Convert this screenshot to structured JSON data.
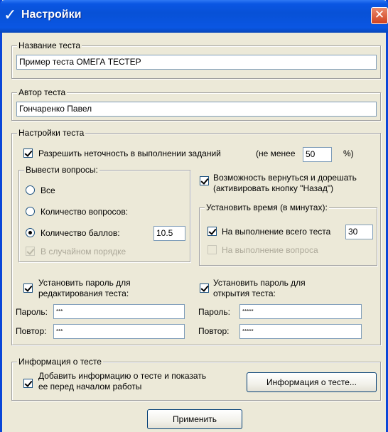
{
  "window": {
    "title": "Настройки",
    "title_icon": "checkmark-icon",
    "close_icon": "close-icon",
    "colors": {
      "titlebar": "#0A56E3",
      "frame": "#0A46D8",
      "background": "#ECE9D8",
      "close": "#D0411F"
    }
  },
  "test_name": {
    "legend": "Название теста",
    "value": "Пример теста ОМЕГА ТЕСТЕР"
  },
  "test_author": {
    "legend": "Автор теста",
    "value": "Гончаренко Павел"
  },
  "test_settings": {
    "legend": "Настройки теста",
    "allow_inaccuracy": {
      "label": "Разрешить неточность в выполнении заданий",
      "checked": true
    },
    "min_prefix": "(не менее",
    "min_value": "50",
    "min_suffix": "%)",
    "output_questions": {
      "legend": "Вывести вопросы:",
      "all": {
        "label": "Все",
        "selected": false
      },
      "count": {
        "label": "Количество вопросов:",
        "selected": false
      },
      "points": {
        "label": "Количество баллов:",
        "selected": true
      },
      "points_value": "10.5",
      "random": {
        "label": "В случайном порядке",
        "checked": true,
        "disabled": true
      }
    },
    "allow_return": {
      "label_line1": "Возможность вернуться и дорешать",
      "label_line2": "(активировать кнопку \"Назад\")",
      "checked": true
    },
    "time": {
      "legend": "Установить время (в минутах):",
      "whole_test": {
        "label": "На выполнение всего теста",
        "checked": true,
        "value": "30"
      },
      "per_question": {
        "label": "На выполнение вопроса",
        "checked": false,
        "disabled": true
      }
    },
    "edit_password": {
      "label_line1": "Установить пароль для",
      "label_line2": "редактирования теста:",
      "checked": true,
      "password_label": "Пароль:",
      "password_value": "***",
      "repeat_label": "Повтор:",
      "repeat_value": "***"
    },
    "open_password": {
      "label_line1": "Установить пароль для",
      "label_line2": "открытия теста:",
      "checked": true,
      "password_label": "Пароль:",
      "password_value": "*****",
      "repeat_label": "Повтор:",
      "repeat_value": "*****"
    }
  },
  "test_info": {
    "legend": "Информация о тесте",
    "add_info": {
      "label_line1": "Добавить информацию о тесте и показать",
      "label_line2": "ее перед началом работы",
      "checked": true
    },
    "info_button": "Информация о тесте..."
  },
  "apply_button": "Применить"
}
